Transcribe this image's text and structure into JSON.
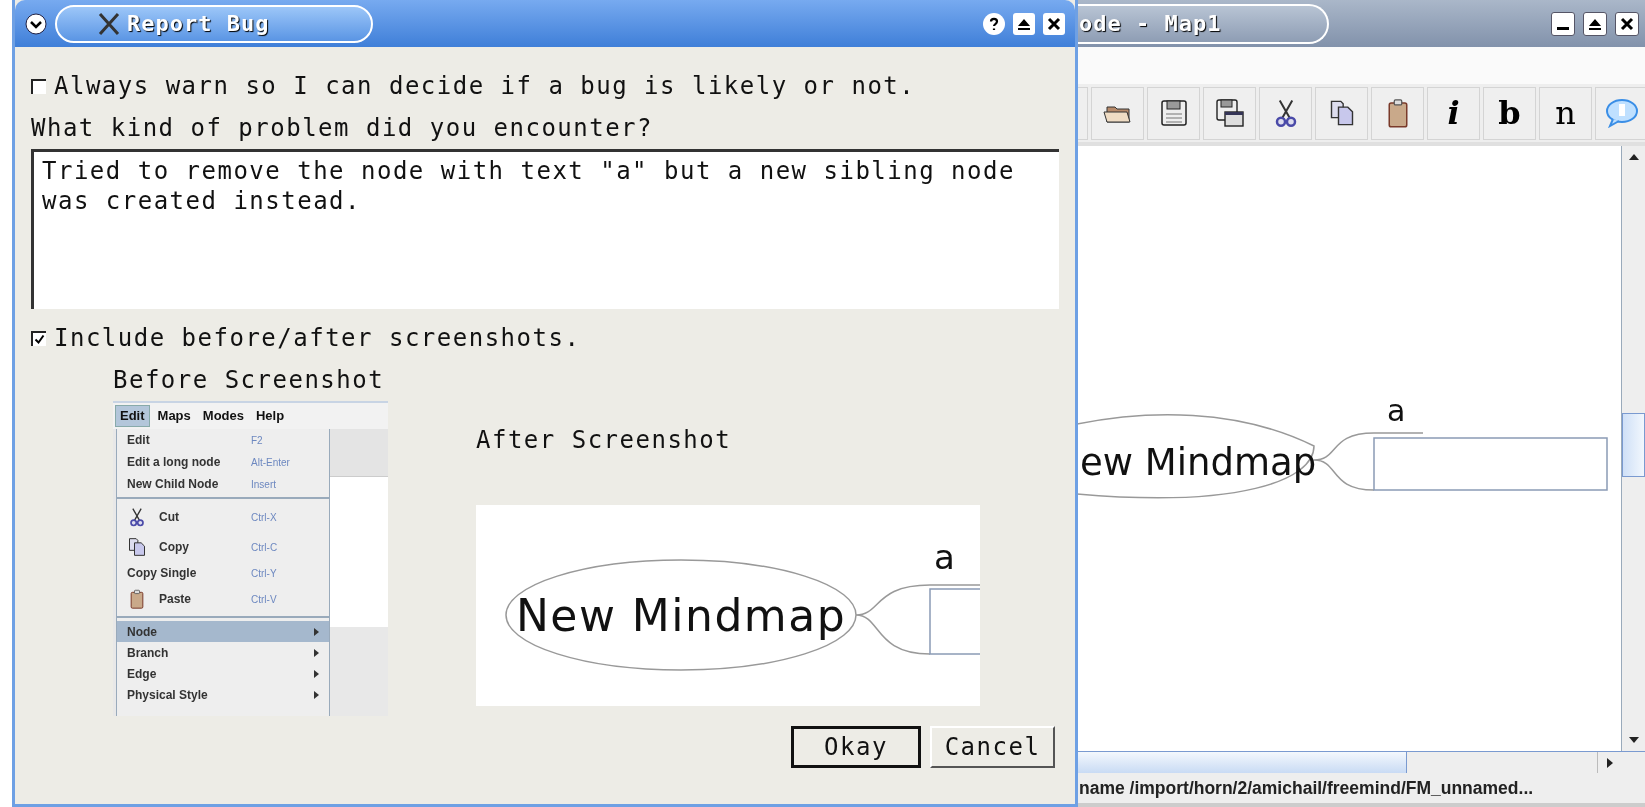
{
  "dialog": {
    "title": "Report Bug",
    "always_warn": {
      "label": "Always warn so I can decide if a bug is likely or not.",
      "checked": false
    },
    "problem_prompt": "What kind of problem did you encounter?",
    "description": {
      "value": "Tried to remove the node with text \"a\" but a new sibling node was created instead."
    },
    "include_screenshots": {
      "label": "Include before/after screenshots.",
      "checked": true
    },
    "before_screenshot": {
      "label": "Before Screenshot",
      "menubar": [
        {
          "label": "Edit",
          "selected": true
        },
        {
          "label": "Maps",
          "selected": false
        },
        {
          "label": "Modes",
          "selected": false
        },
        {
          "label": "Help",
          "selected": false
        }
      ],
      "menu_items": [
        {
          "kind": "item",
          "label": "Edit",
          "shortcut": "F2",
          "selected": false
        },
        {
          "kind": "item",
          "label": "Edit a long node",
          "shortcut": "Alt-Enter",
          "selected": false
        },
        {
          "kind": "item",
          "label": "New Child Node",
          "shortcut": "Insert",
          "selected": false
        },
        {
          "kind": "separator"
        },
        {
          "kind": "scissors_item",
          "label": "Cut",
          "shortcut": "Ctrl-X",
          "selected": false
        },
        {
          "kind": "copy_item",
          "label": "Copy",
          "shortcut": "Ctrl-C",
          "selected": false
        },
        {
          "kind": "item",
          "label": "Copy Single",
          "shortcut": "Ctrl-Y",
          "selected": false
        },
        {
          "kind": "clipboard_item",
          "label": "Paste",
          "shortcut": "Ctrl-V",
          "selected": false
        },
        {
          "kind": "separator"
        },
        {
          "kind": "submenu",
          "label": "Node",
          "selected": true
        },
        {
          "kind": "submenu",
          "label": "Branch",
          "selected": false
        },
        {
          "kind": "submenu",
          "label": "Edge",
          "selected": false
        },
        {
          "kind": "submenu",
          "label": "Physical Style",
          "selected": false
        }
      ]
    },
    "after_screenshot": {
      "label": "After Screenshot",
      "root_node": "New Mindmap",
      "child_node": "a"
    },
    "buttons": [
      {
        "label": "Okay",
        "default": true
      },
      {
        "label": "Cancel",
        "default": false
      }
    ]
  },
  "background_window": {
    "title": "ode - Map1",
    "toolbar": [
      {
        "kind": "blank"
      },
      {
        "kind": "folder"
      },
      {
        "kind": "save"
      },
      {
        "kind": "save_as"
      },
      {
        "kind": "scissors"
      },
      {
        "kind": "copy"
      },
      {
        "kind": "clipboard"
      },
      {
        "kind": "italic",
        "label": "i"
      },
      {
        "kind": "bold",
        "label": "b"
      },
      {
        "kind": "normal",
        "label": "n"
      },
      {
        "kind": "note"
      }
    ],
    "root_node": "ew Mindmap",
    "child_node": "a",
    "status_bar": "name /import/horn/2/amichail/freemind/FM_unnamed..."
  }
}
